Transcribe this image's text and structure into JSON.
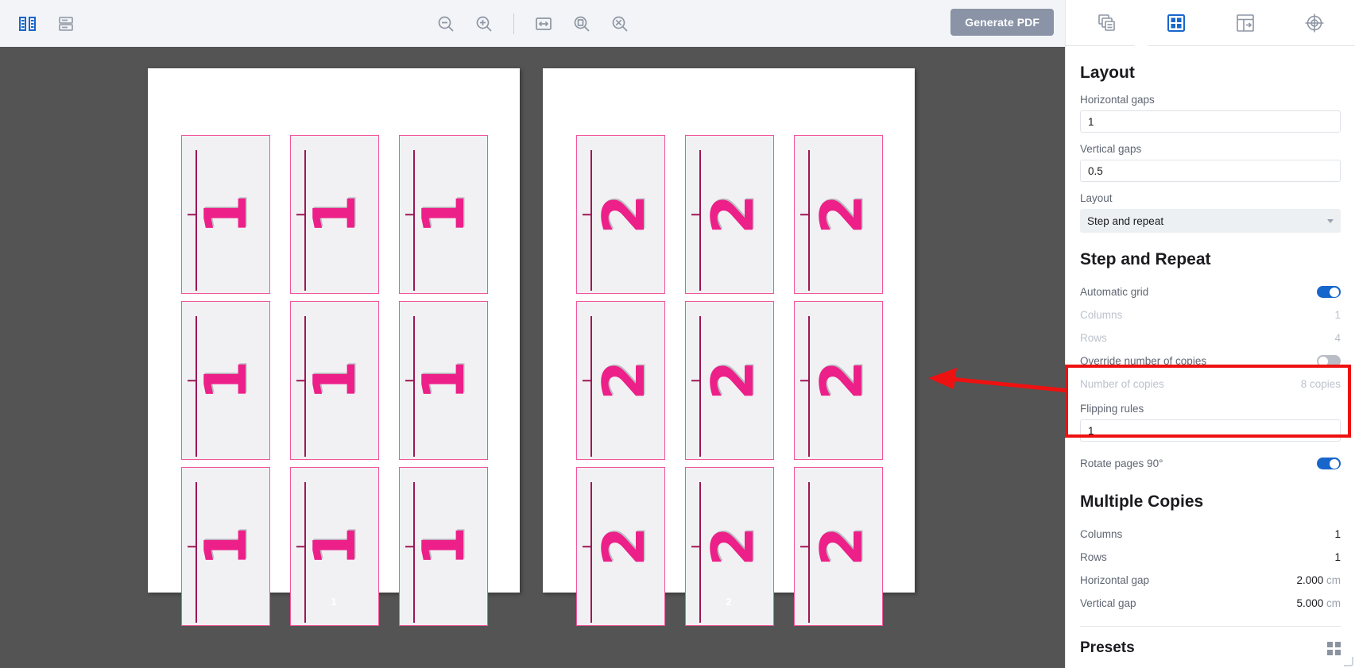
{
  "toolbar": {
    "icons_left": [
      "split-view-icon",
      "save-icon"
    ],
    "icons_center": [
      "zoom-out-icon",
      "zoom-in-icon",
      "fit-width-icon",
      "fit-page-icon",
      "zoom-reset-icon"
    ],
    "generate_pdf_label": "Generate PDF"
  },
  "canvas": {
    "background_color": "#545454",
    "sheets": [
      {
        "page_label": "1",
        "digit": "1",
        "rows": 3,
        "columns": 3
      },
      {
        "page_label": "2",
        "digit": "2",
        "rows": 3,
        "columns": 3
      }
    ],
    "card_border_color": "#f2559a",
    "digit_color": "#ec2088"
  },
  "annotation": {
    "box_color": "#ee1111",
    "arrow_color": "#ee1111"
  },
  "panel": {
    "tabs": [
      {
        "name": "pages-icon",
        "active": false
      },
      {
        "name": "layout-grid-icon",
        "active": true
      },
      {
        "name": "marks-icon",
        "active": false
      },
      {
        "name": "registration-target-icon",
        "active": false
      }
    ],
    "layout": {
      "title": "Layout",
      "horizontal_gaps_label": "Horizontal gaps",
      "horizontal_gaps_value": "1",
      "vertical_gaps_label": "Vertical gaps",
      "vertical_gaps_value": "0.5",
      "layout_label": "Layout",
      "layout_value": "Step and repeat"
    },
    "step_and_repeat": {
      "title": "Step and Repeat",
      "automatic_grid_label": "Automatic grid",
      "automatic_grid_on": true,
      "columns_label": "Columns",
      "columns_value": "1",
      "rows_label": "Rows",
      "rows_value": "4",
      "override_copies_label": "Override number of copies",
      "override_copies_on": false,
      "number_of_copies_label": "Number of copies",
      "number_of_copies_value": "8 copies",
      "flipping_rules_label": "Flipping rules",
      "flipping_rules_value": "1",
      "rotate_pages_label": "Rotate pages 90°",
      "rotate_pages_on": true
    },
    "multiple_copies": {
      "title": "Multiple Copies",
      "columns_label": "Columns",
      "columns_value": "1",
      "rows_label": "Rows",
      "rows_value": "1",
      "horizontal_gap_label": "Horizontal gap",
      "horizontal_gap_value": "2.000",
      "horizontal_gap_unit": "cm",
      "vertical_gap_label": "Vertical gap",
      "vertical_gap_value": "5.000",
      "vertical_gap_unit": "cm"
    },
    "presets": {
      "title": "Presets"
    }
  }
}
